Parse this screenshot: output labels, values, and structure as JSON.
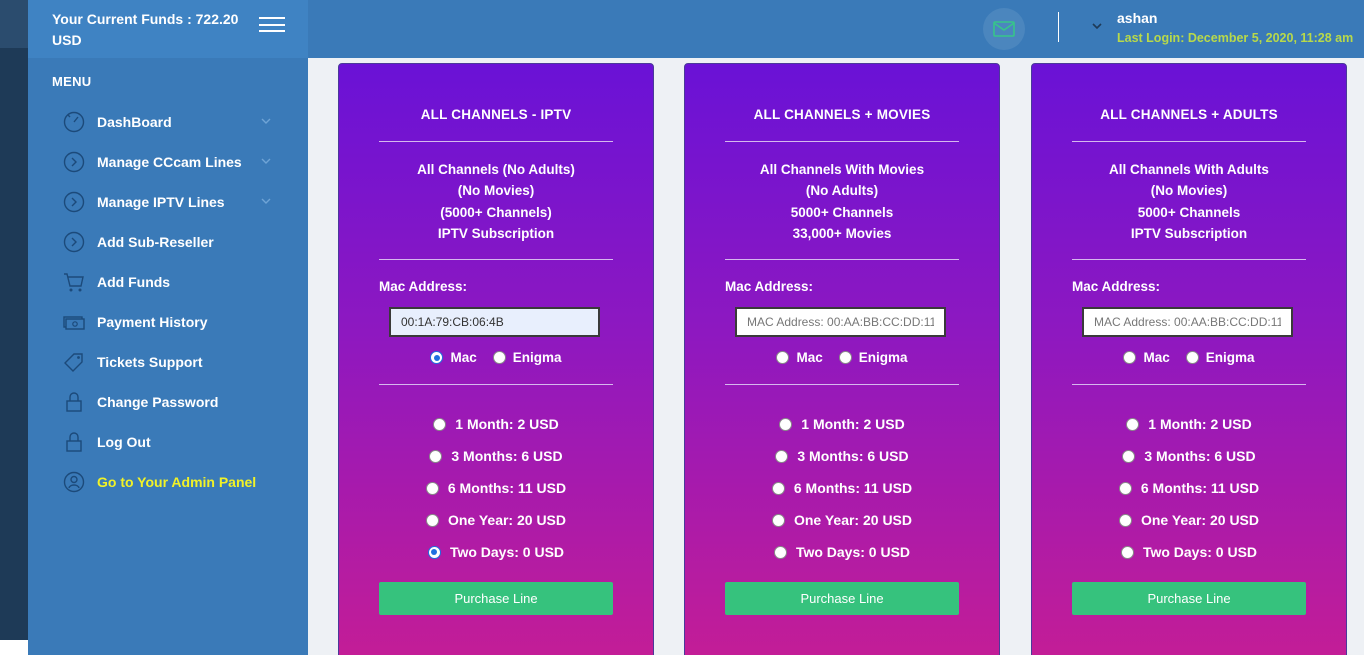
{
  "sidebar": {
    "funds": "Your Current Funds : 722.20 USD",
    "menu_title": "MENU",
    "items": [
      {
        "label": "DashBoard",
        "icon": "dashboard-icon",
        "chevron": true
      },
      {
        "label": "Manage CCcam Lines",
        "icon": "chevron-circle-icon",
        "chevron": true
      },
      {
        "label": "Manage IPTV Lines",
        "icon": "chevron-circle-icon",
        "chevron": true
      },
      {
        "label": "Add Sub-Reseller",
        "icon": "chevron-circle-icon",
        "chevron": false
      },
      {
        "label": "Add Funds",
        "icon": "cart-icon",
        "chevron": false
      },
      {
        "label": "Payment History",
        "icon": "money-icon",
        "chevron": false
      },
      {
        "label": "Tickets Support",
        "icon": "tag-icon",
        "chevron": false
      },
      {
        "label": "Change Password",
        "icon": "lock-icon",
        "chevron": false
      },
      {
        "label": "Log Out",
        "icon": "lock-icon",
        "chevron": false
      },
      {
        "label": "Go to Your Admin Panel",
        "icon": "user-circle-icon",
        "chevron": false,
        "highlight": true
      }
    ]
  },
  "topbar": {
    "user_name": "ashan",
    "last_login": "Last Login: December 5, 2020, 11:28 am",
    "highlight_color": "#b8d94a"
  },
  "cards": [
    {
      "title": "ALL CHANNELS - IPTV",
      "desc": [
        "All Channels (No Adults)",
        "(No Movies)",
        "(5000+ Channels)",
        "IPTV Subscription"
      ],
      "mac_label": "Mac Address:",
      "mac_value": "00:1A:79:CB:06:4B",
      "mac_placeholder": "MAC Address: 00:AA:BB:CC:DD:11",
      "device_options": [
        "Mac",
        "Enigma"
      ],
      "device_selected": 0,
      "plans": [
        "1 Month: 2 USD",
        "3 Months: 6 USD",
        "6 Months: 11 USD",
        "One Year: 20 USD",
        "Two Days: 0 USD"
      ],
      "plan_selected": 4,
      "button": "Purchase Line"
    },
    {
      "title": "ALL CHANNELS + MOVIES",
      "desc": [
        "All Channels With Movies",
        "(No Adults)",
        "5000+ Channels",
        "33,000+ Movies"
      ],
      "mac_label": "Mac Address:",
      "mac_value": "",
      "mac_placeholder": "MAC Address: 00:AA:BB:CC:DD:11",
      "device_options": [
        "Mac",
        "Enigma"
      ],
      "device_selected": -1,
      "plans": [
        "1 Month: 2 USD",
        "3 Months: 6 USD",
        "6 Months: 11 USD",
        "One Year: 20 USD",
        "Two Days: 0 USD"
      ],
      "plan_selected": -1,
      "button": "Purchase Line"
    },
    {
      "title": "ALL CHANNELS + ADULTS",
      "desc": [
        "All Channels With Adults",
        "(No Movies)",
        "5000+ Channels",
        "IPTV Subscription"
      ],
      "mac_label": "Mac Address:",
      "mac_value": "",
      "mac_placeholder": "MAC Address: 00:AA:BB:CC:DD:11",
      "device_options": [
        "Mac",
        "Enigma"
      ],
      "device_selected": -1,
      "plans": [
        "1 Month: 2 USD",
        "3 Months: 6 USD",
        "6 Months: 11 USD",
        "One Year: 20 USD",
        "Two Days: 0 USD"
      ],
      "plan_selected": -1,
      "button": "Purchase Line"
    }
  ]
}
